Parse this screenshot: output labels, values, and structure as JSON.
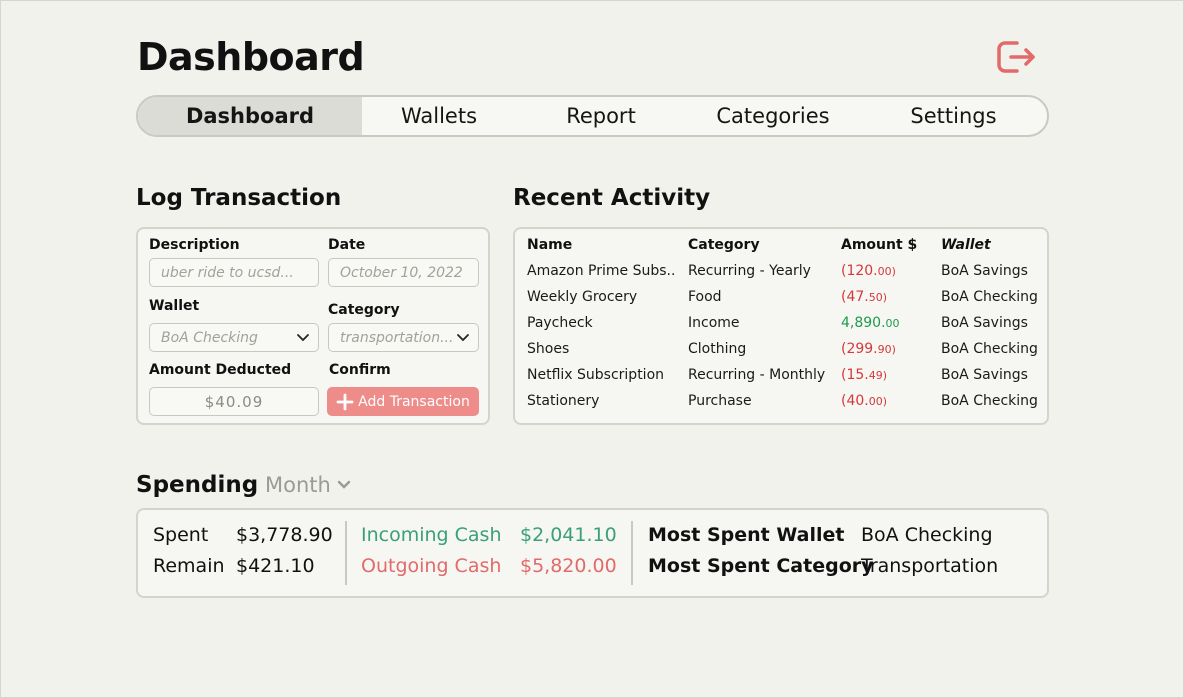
{
  "header": {
    "title": "Dashboard"
  },
  "nav": {
    "tabs": [
      {
        "label": "Dashboard"
      },
      {
        "label": "Wallets"
      },
      {
        "label": "Report"
      },
      {
        "label": "Categories"
      },
      {
        "label": "Settings"
      }
    ]
  },
  "log": {
    "title": "Log Transaction",
    "description_label": "Description",
    "description_placeholder": "uber ride to ucsd...",
    "date_label": "Date",
    "date_placeholder": "October 10, 2022",
    "wallet_label": "Wallet",
    "wallet_value": "BoA Checking",
    "category_label": "Category",
    "category_value": "transportation...",
    "amount_label": "Amount Deducted",
    "amount_value": "$40.09",
    "confirm_label": "Confirm",
    "add_button": "Add Transaction"
  },
  "activity": {
    "title": "Recent Activity",
    "headers": [
      "Name",
      "Category",
      "Amount $",
      "Wallet"
    ],
    "rows": [
      {
        "name": "Amazon Prime Subs..",
        "category": "Recurring - Yearly",
        "amount_main": "(120.",
        "amount_cents": "00)",
        "type": "neg",
        "wallet": "BoA Savings"
      },
      {
        "name": "Weekly Grocery",
        "category": "Food",
        "amount_main": "(47.",
        "amount_cents": "50)",
        "type": "neg",
        "wallet": "BoA Checking"
      },
      {
        "name": "Paycheck",
        "category": "Income",
        "amount_main": "4,890.",
        "amount_cents": "00",
        "type": "pos",
        "wallet": "BoA Savings"
      },
      {
        "name": "Shoes",
        "category": "Clothing",
        "amount_main": "(299.",
        "amount_cents": "90)",
        "type": "neg",
        "wallet": "BoA Checking"
      },
      {
        "name": "Netflix Subscription",
        "category": "Recurring - Monthly",
        "amount_main": "(15.",
        "amount_cents": "49)",
        "type": "neg",
        "wallet": "BoA Savings"
      },
      {
        "name": "Stationery",
        "category": "Purchase",
        "amount_main": "(40.",
        "amount_cents": "00)",
        "type": "neg",
        "wallet": "BoA Checking"
      }
    ]
  },
  "spending": {
    "title": "Spending",
    "period": "Month",
    "spent_label": "Spent",
    "spent_value": "$3,778.90",
    "remain_label": "Remain",
    "remain_value": "$421.10",
    "incoming_label": "Incoming Cash",
    "incoming_value": "$2,041.10",
    "outgoing_label": "Outgoing Cash",
    "outgoing_value": "$5,820.00",
    "most_wallet_label": "Most Spent Wallet",
    "most_wallet_value": "BoA Checking",
    "most_category_label": "Most Spent Category",
    "most_category_value": "Transportation"
  },
  "colors": {
    "accent_red": "#e26a6a",
    "incoming_green": "#3aa07a",
    "outgoing_red": "#e26a6a",
    "button_pink": "#ee8c8a"
  },
  "icons": {
    "logout": "logout-icon",
    "chevron": "chevron-down-icon",
    "plus": "plus-icon"
  }
}
